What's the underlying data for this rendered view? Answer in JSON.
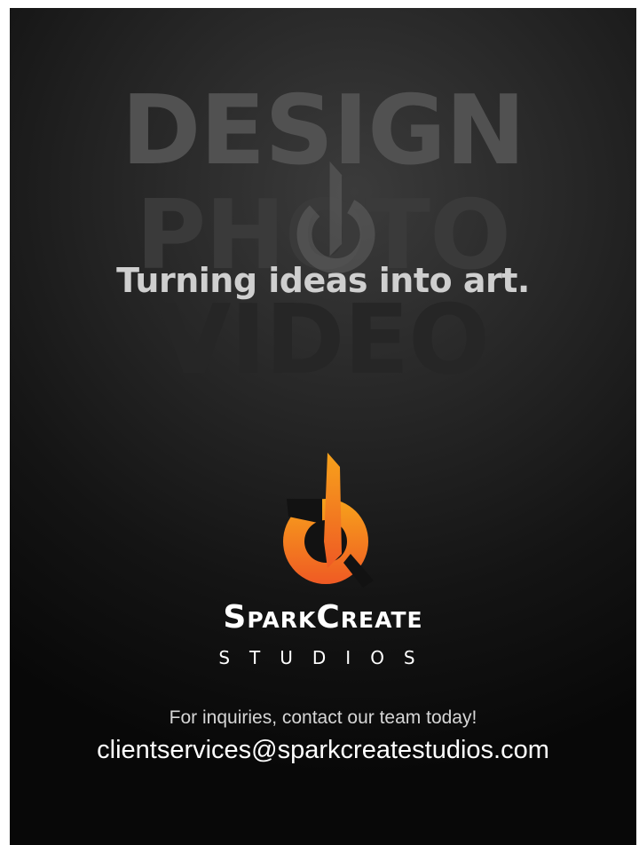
{
  "hero": {
    "words": [
      "DESIGN",
      "PHOTO",
      "VIDEO"
    ],
    "tagline": "Turning ideas into art."
  },
  "brand": {
    "name": "SparkCreate",
    "sub": "STUDIOS",
    "logo_icon": "flame-power-icon",
    "accent_colors": [
      "#f7a21b",
      "#ef5a24"
    ]
  },
  "contact": {
    "inquiry": "For inquiries, contact our team today!",
    "email": "clientservices@sparkcreatestudios.com"
  },
  "colors": {
    "background": "#111111",
    "text": "#ffffff"
  }
}
